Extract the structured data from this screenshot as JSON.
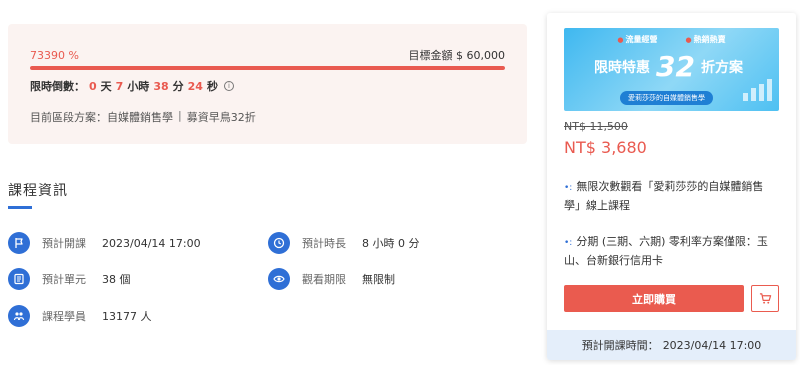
{
  "funding": {
    "percent_text": "73390 %",
    "goal_text": "目標金額 $ 60,000",
    "progress": 1.0,
    "countdown_label": "限時倒數：",
    "days": "0",
    "days_unit": "天",
    "hours": "7",
    "hours_unit": "小時",
    "minutes": "38",
    "minutes_unit": "分",
    "seconds": "24",
    "seconds_unit": "秒",
    "info_icon": "i",
    "plan_label": "目前區段方案：自媒體銷售學",
    "plan_separator": "|",
    "plan_value": "募資早鳥32折"
  },
  "course_info": {
    "title": "課程資訊",
    "items": [
      {
        "icon": "flag-icon",
        "label": "預計開課",
        "value": "2023/04/14 17:00"
      },
      {
        "icon": "clock-icon",
        "label": "預計時長",
        "value": "8 小時 0 分"
      },
      {
        "icon": "list-icon",
        "label": "預計單元",
        "value": "38 個"
      },
      {
        "icon": "eye-icon",
        "label": "觀看期限",
        "value": "無限制"
      },
      {
        "icon": "people-icon",
        "label": "課程學員",
        "value": "13177 人"
      }
    ]
  },
  "side": {
    "banner": {
      "tag1": "流量經營",
      "tag2": "熱銷熱賣",
      "text1": "限時特惠",
      "text2": "32",
      "text3": "折方案",
      "subtitle": "愛莉莎莎的自媒體銷售學"
    },
    "old_price": "NT$ 11,500",
    "new_price": "NT$ 3,680",
    "feature1": "無限次數觀看「愛莉莎莎的自媒體銷售學」線上課程",
    "feature2": "分期 (三期、六期) 零利率方案僅限：玉山、台新銀行信用卡",
    "bullet": "•:",
    "buy_label": "立即購買",
    "start_label": "預計開課時間：",
    "start_value": "2023/04/14 17:00"
  },
  "colors": {
    "accent_red": "#e95a50",
    "accent_blue": "#2f6fd6",
    "card_bg": "#fbf3f1"
  }
}
